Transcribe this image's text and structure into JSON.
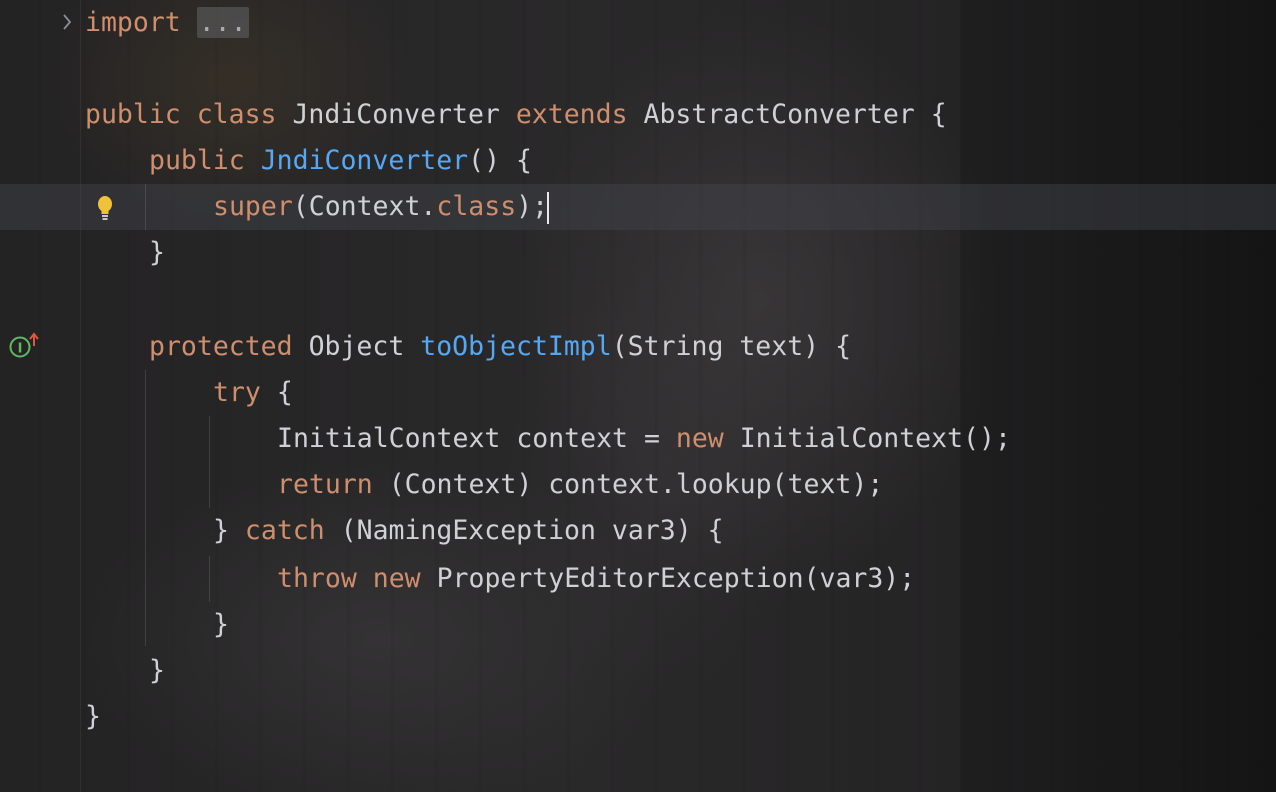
{
  "editor": {
    "language": "java",
    "lines": {
      "l1": {
        "kw": "import",
        "fold": "..."
      },
      "l3": {
        "kw1": "public",
        "kw2": "class",
        "name": "JndiConverter",
        "kw3": "extends",
        "parent": "AbstractConverter",
        "brace": "{"
      },
      "l4": {
        "kw": "public",
        "fn": "JndiConverter",
        "rest": "() {"
      },
      "l5": {
        "kw": "super",
        "p1": "(Context.",
        "kw2": "class",
        "p2": ");"
      },
      "l6": {
        "text": "}"
      },
      "l8": {
        "kw": "protected",
        "type": "Object",
        "fn": "toObjectImpl",
        "rest": "(String text) {"
      },
      "l9": {
        "kw": "try",
        "rest": " {"
      },
      "l10": {
        "a": "InitialContext context = ",
        "kw": "new",
        "b": " InitialContext();"
      },
      "l11": {
        "kw": "return",
        "rest": " (Context) context.lookup(text);"
      },
      "l12": {
        "a": "} ",
        "kw": "catch",
        "b": " (NamingException var3) {"
      },
      "l13": {
        "kw1": "throw",
        "kw2": "new",
        "rest": " PropertyEditorException(var3);"
      },
      "l14": {
        "text": "}"
      },
      "l15": {
        "text": "}"
      },
      "l16": {
        "text": "}"
      }
    },
    "gutter": {
      "fold_icon": "chevron-right-icon",
      "intention_icon": "lightbulb-icon",
      "implements_icon": "implemented-method-icon"
    }
  },
  "colors": {
    "keyword": "#cf8e6d",
    "function": "#56a8f5",
    "text": "#cfd1d6"
  }
}
